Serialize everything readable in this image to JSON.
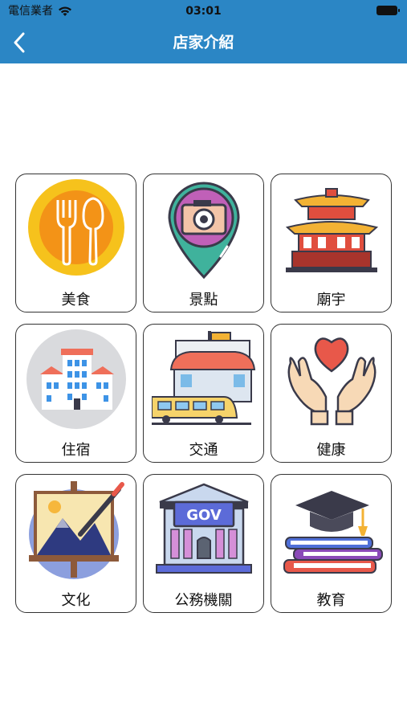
{
  "status_bar": {
    "carrier": "電信業者",
    "time": "03:01"
  },
  "nav": {
    "title": "店家介紹",
    "back_icon": "chevron-left-icon"
  },
  "categories": [
    {
      "label": "美食",
      "icon": "fork-spoon-icon"
    },
    {
      "label": "景點",
      "icon": "camera-pin-icon"
    },
    {
      "label": "廟宇",
      "icon": "temple-icon"
    },
    {
      "label": "住宿",
      "icon": "hotel-icon"
    },
    {
      "label": "交通",
      "icon": "train-station-icon"
    },
    {
      "label": "健康",
      "icon": "hands-heart-icon"
    },
    {
      "label": "文化",
      "icon": "painting-easel-icon"
    },
    {
      "label": "公務機關",
      "icon": "gov-building-icon"
    },
    {
      "label": "教育",
      "icon": "graduation-books-icon"
    }
  ],
  "colors": {
    "header": "#2b86c5",
    "title_text": "#ffffff"
  }
}
